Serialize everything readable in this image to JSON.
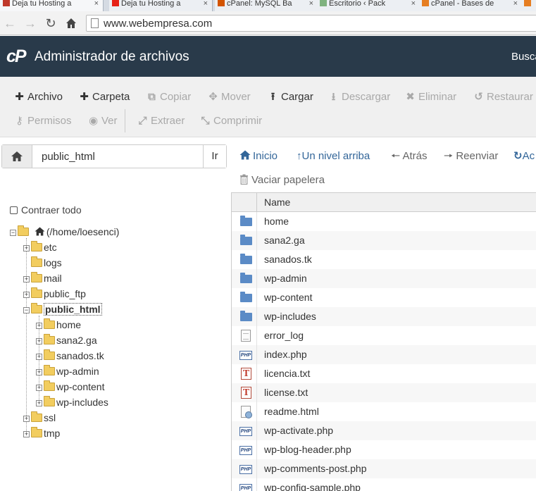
{
  "browser": {
    "tabs": [
      {
        "title": "Deja tu Hosting a",
        "close": "×"
      },
      {
        "title": "Deja tu Hosting a",
        "close": "×"
      },
      {
        "title": "cPanel: MySQL Ba",
        "close": "×"
      },
      {
        "title": "Escritorio ‹ Pack",
        "close": "×"
      },
      {
        "title": "cPanel - Bases de",
        "close": "×"
      }
    ],
    "url": "www.webempresa.com"
  },
  "header": {
    "logo": "cP",
    "title": "Administrador de archivos",
    "search": "Busca"
  },
  "toolbar": {
    "row1": [
      {
        "label": "Archivo",
        "icon": "plus-icon",
        "glyph": "✚",
        "enabled": true
      },
      {
        "label": "Carpeta",
        "icon": "plus-icon",
        "glyph": "✚",
        "enabled": true
      },
      {
        "label": "Copiar",
        "icon": "copy-icon",
        "glyph": "⧉",
        "enabled": false
      },
      {
        "label": "Mover",
        "icon": "move-icon",
        "glyph": "✥",
        "enabled": false
      },
      {
        "label": "Cargar",
        "icon": "upload-icon",
        "glyph": "⭱",
        "enabled": true
      },
      {
        "label": "Descargar",
        "icon": "download-icon",
        "glyph": "⭳",
        "enabled": false
      },
      {
        "label": "Eliminar",
        "icon": "delete-icon",
        "glyph": "✖",
        "enabled": false
      },
      {
        "label": "Restaurar",
        "icon": "restore-icon",
        "glyph": "↺",
        "enabled": false
      }
    ],
    "row2": [
      {
        "label": "Permisos",
        "icon": "key-icon",
        "glyph": "⚷",
        "enabled": false
      },
      {
        "label": "Ver",
        "icon": "eye-icon",
        "glyph": "◉",
        "enabled": false
      },
      {
        "label": "Extraer",
        "icon": "expand-icon",
        "glyph": "⤢",
        "enabled": false
      },
      {
        "label": "Comprimir",
        "icon": "compress-icon",
        "glyph": "⤡",
        "enabled": false
      }
    ]
  },
  "pathbar": {
    "value": "public_html",
    "go_label": "Ir"
  },
  "nav": {
    "home": "Inicio",
    "up": "Un nivel arriba",
    "back": "Atrás",
    "forward": "Reenviar",
    "reload": "Ac",
    "empty_trash": "Vaciar papelera"
  },
  "tree": {
    "collapse_all": "Contraer todo",
    "root": "(/home/loesenci)",
    "items": [
      {
        "label": "etc",
        "level": 1,
        "expandable": true
      },
      {
        "label": "logs",
        "level": 1,
        "expandable": false
      },
      {
        "label": "mail",
        "level": 1,
        "expandable": true
      },
      {
        "label": "public_ftp",
        "level": 1,
        "expandable": true
      },
      {
        "label": "public_html",
        "level": 1,
        "expandable": true,
        "expanded": true,
        "selected": true
      },
      {
        "label": "home",
        "level": 2,
        "expandable": true
      },
      {
        "label": "sana2.ga",
        "level": 2,
        "expandable": true
      },
      {
        "label": "sanados.tk",
        "level": 2,
        "expandable": true
      },
      {
        "label": "wp-admin",
        "level": 2,
        "expandable": true
      },
      {
        "label": "wp-content",
        "level": 2,
        "expandable": true
      },
      {
        "label": "wp-includes",
        "level": 2,
        "expandable": true
      },
      {
        "label": "ssl",
        "level": 1,
        "expandable": true
      },
      {
        "label": "tmp",
        "level": 1,
        "expandable": true
      }
    ]
  },
  "files": {
    "column_name": "Name",
    "rows": [
      {
        "name": "home",
        "type": "folder"
      },
      {
        "name": "sana2.ga",
        "type": "folder"
      },
      {
        "name": "sanados.tk",
        "type": "folder"
      },
      {
        "name": "wp-admin",
        "type": "folder"
      },
      {
        "name": "wp-content",
        "type": "folder"
      },
      {
        "name": "wp-includes",
        "type": "folder"
      },
      {
        "name": "error_log",
        "type": "doc"
      },
      {
        "name": "index.php",
        "type": "php"
      },
      {
        "name": "licencia.txt",
        "type": "txt"
      },
      {
        "name": "license.txt",
        "type": "txt"
      },
      {
        "name": "readme.html",
        "type": "html"
      },
      {
        "name": "wp-activate.php",
        "type": "php"
      },
      {
        "name": "wp-blog-header.php",
        "type": "php"
      },
      {
        "name": "wp-comments-post.php",
        "type": "php"
      },
      {
        "name": "wp-config-sample.php",
        "type": "php"
      }
    ]
  },
  "colors": {
    "header_bg": "#293a4a",
    "link": "#336699",
    "folder_blue": "#5b8bc6",
    "folder_yellow": "#f2cd5f"
  }
}
